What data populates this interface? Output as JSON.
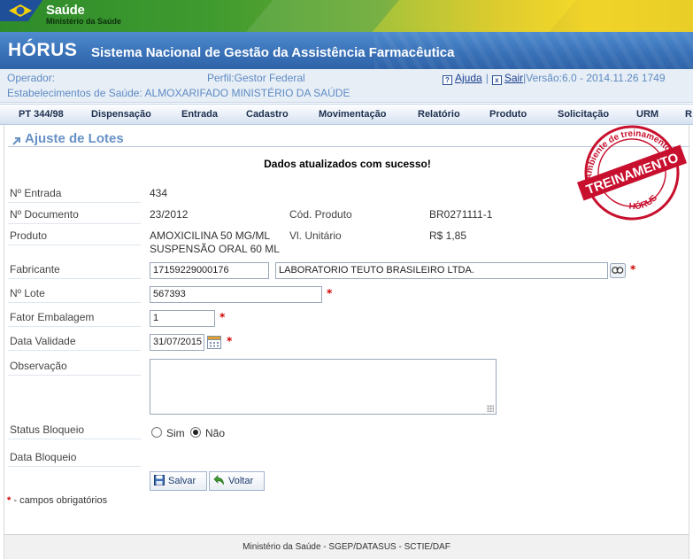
{
  "banner": {
    "brand_title": "Saúde",
    "brand_subtitle": "Ministério da Saúde"
  },
  "header": {
    "app_name": "HÓRUS",
    "app_description": "Sistema Nacional de Gestão da Assistência Farmacêutica"
  },
  "info": {
    "operator_label": "Operador:",
    "profile": "Perfil:Gestor Federal",
    "establishments": "Estabelecimentos de Saúde: ALMOXARIFADO MINISTÉRIO DA SAÚDE",
    "help_label": "Ajuda",
    "exit_label": "Sair",
    "separator": "|",
    "version": "|Versão:6.0 - 2014.11.26 1749"
  },
  "menu": {
    "items": [
      {
        "label": "PT 344/98"
      },
      {
        "label": "Dispensação"
      },
      {
        "label": "Entrada"
      },
      {
        "label": "Cadastro"
      },
      {
        "label": "Movimentação"
      },
      {
        "label": "Relatório"
      },
      {
        "label": "Produto"
      },
      {
        "label": "Solicitação"
      },
      {
        "label": "URM"
      },
      {
        "label": "R"
      }
    ]
  },
  "page": {
    "title": "Ajuste de Lotes",
    "success_message": "Dados atualizados com sucesso!"
  },
  "stamp": {
    "top_text": "Ambiente de treinamento",
    "banner_text": "TREINAMENTO",
    "bottom_text": "HÓRUS"
  },
  "form": {
    "entrada_label": "Nº Entrada",
    "entrada_value": "434",
    "documento_label": "Nº Documento",
    "documento_value": "23/2012",
    "cod_produto_label": "Cód. Produto",
    "cod_produto_value": "BR0271111-1",
    "produto_label": "Produto",
    "produto_line1": "AMOXICILINA 50 MG/ML",
    "produto_line2": "SUSPENSÃO ORAL 60 ML",
    "vl_unitario_label": "Vl. Unitário",
    "vl_unitario_value": "R$ 1,85",
    "fabricante_label": "Fabricante",
    "fabricante_code": "17159229000176",
    "fabricante_name": "LABORATORIO TEUTO BRASILEIRO LTDA.",
    "lote_label": "Nº Lote",
    "lote_value": "567393",
    "fator_label": "Fator Embalagem",
    "fator_value": "1",
    "validade_label": "Data Validade",
    "validade_value": "31/07/2015",
    "observacao_label": "Observação",
    "observacao_value": "",
    "status_label": "Status Bloqueio",
    "status_sim": "Sim",
    "status_nao": "Não",
    "status_selected": "Não",
    "data_bloqueio_label": "Data Bloqueio",
    "required_mark": "*",
    "required_note": "- campos obrigatórios"
  },
  "buttons": {
    "save": "Salvar",
    "back": "Voltar"
  },
  "footer": {
    "text": "Ministério da Saúde - SGEP/DATASUS - SCTIE/DAF"
  },
  "colors": {
    "title_bar": "#3a72b8",
    "heading": "#6791c6",
    "required": "#d00000",
    "stamp": "#c8102e"
  }
}
